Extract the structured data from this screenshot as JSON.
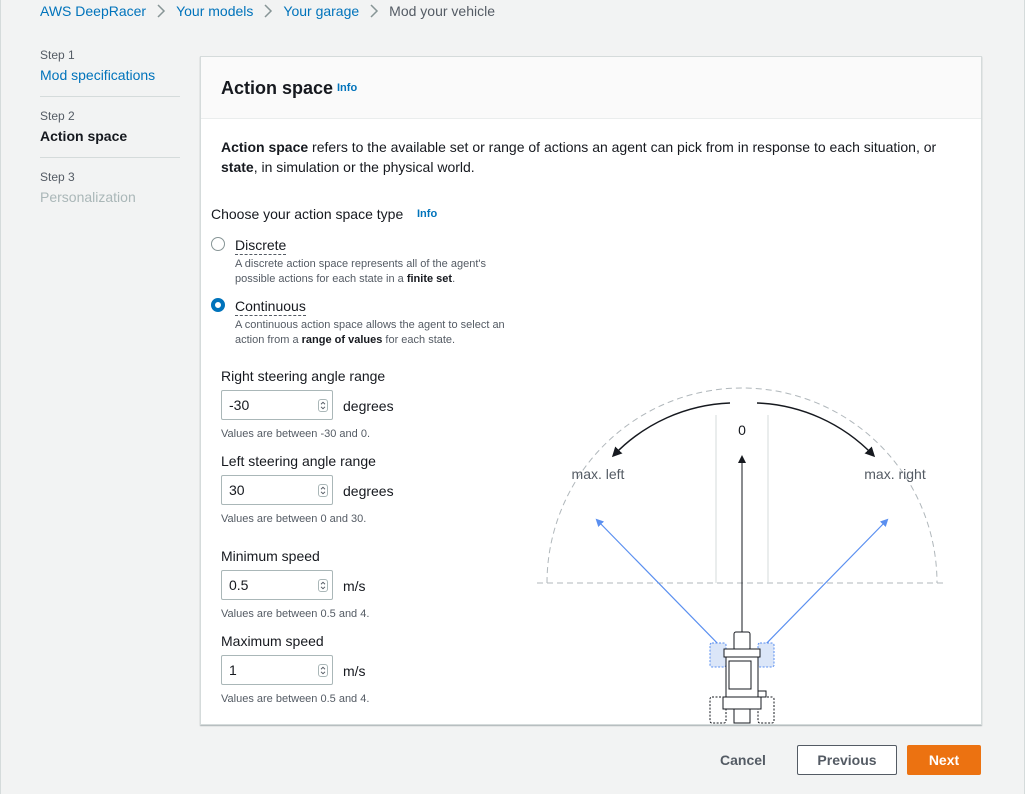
{
  "breadcrumb": {
    "items": [
      "AWS DeepRacer",
      "Your models",
      "Your garage"
    ],
    "current": "Mod your vehicle"
  },
  "steps": [
    {
      "number": "Step 1",
      "label": "Mod specifications",
      "state": "link"
    },
    {
      "number": "Step 2",
      "label": "Action space",
      "state": "active"
    },
    {
      "number": "Step 3",
      "label": "Personalization",
      "state": "disabled"
    }
  ],
  "panel": {
    "title": "Action space",
    "info": "Info",
    "description_bold1": "Action space",
    "description_part1": " refers to the available set or range of actions an agent can pick from in response to each situation, or ",
    "description_bold2": "state",
    "description_part2": ", in simulation or the physical world."
  },
  "action_type": {
    "label": "Choose your action space type",
    "info": "Info",
    "selected": "Continuous",
    "options": [
      {
        "label": "Discrete",
        "desc_part1": "A discrete action space represents all of the agent's possible actions for each state in a ",
        "desc_bold": "finite set",
        "desc_part2": "."
      },
      {
        "label": "Continuous",
        "desc_part1": "A continuous action space allows the agent to select an action from a ",
        "desc_bold": "range of values",
        "desc_part2": " for each state."
      }
    ]
  },
  "fields": [
    {
      "label": "Right steering angle range",
      "value": "-30",
      "unit": "degrees",
      "hint": "Values are between -30 and 0."
    },
    {
      "label": "Left steering angle range",
      "value": "30",
      "unit": "degrees",
      "hint": "Values are between 0 and 30."
    },
    {
      "label": "Minimum speed",
      "value": "0.5",
      "unit": "m/s",
      "hint": "Values are between 0.5 and 4."
    },
    {
      "label": "Maximum speed",
      "value": "1",
      "unit": "m/s",
      "hint": "Values are between 0.5 and 4."
    }
  ],
  "diagram": {
    "center_label": "0",
    "left_label": "max. left",
    "right_label": "max. right",
    "vector_color": "#5a8ff0"
  },
  "buttons": {
    "cancel": "Cancel",
    "previous": "Previous",
    "next": "Next"
  },
  "colors": {
    "link": "#0073bb",
    "primary": "#ec7211",
    "border": "#d5dbdb"
  }
}
